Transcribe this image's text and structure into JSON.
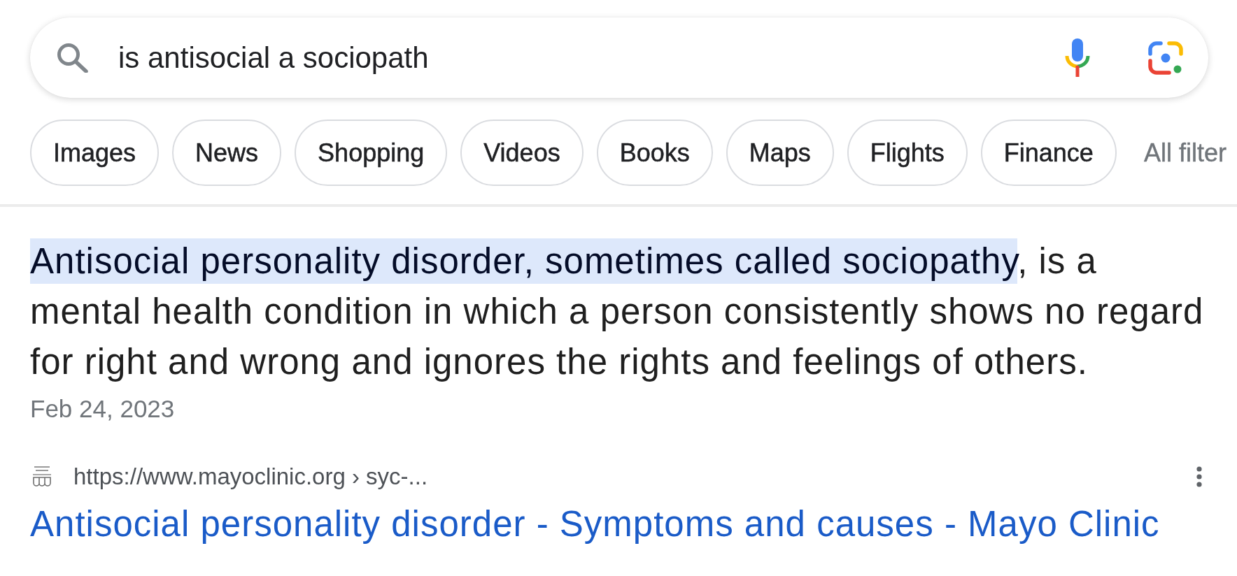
{
  "search": {
    "value": "is antisocial a sociopath"
  },
  "filters": [
    {
      "label": "Images",
      "kind": "chip"
    },
    {
      "label": "News",
      "kind": "chip"
    },
    {
      "label": "Shopping",
      "kind": "chip"
    },
    {
      "label": "Videos",
      "kind": "chip"
    },
    {
      "label": "Books",
      "kind": "chip"
    },
    {
      "label": "Maps",
      "kind": "chip"
    },
    {
      "label": "Flights",
      "kind": "chip"
    },
    {
      "label": "Finance",
      "kind": "chip"
    },
    {
      "label": "All filter",
      "kind": "link"
    }
  ],
  "snippet": {
    "highlight": "Antisocial personality disorder, sometimes called sociopathy",
    "text": ", is a mental health condition in which a person consistently shows no regard for right and wrong and ignores the rights and feelings of others.",
    "date": "Feb 24, 2023"
  },
  "result": {
    "url": "https://www.mayoclinic.org › syc-...",
    "title": "Antisocial personality disorder - Symptoms and causes - Mayo Clinic"
  }
}
